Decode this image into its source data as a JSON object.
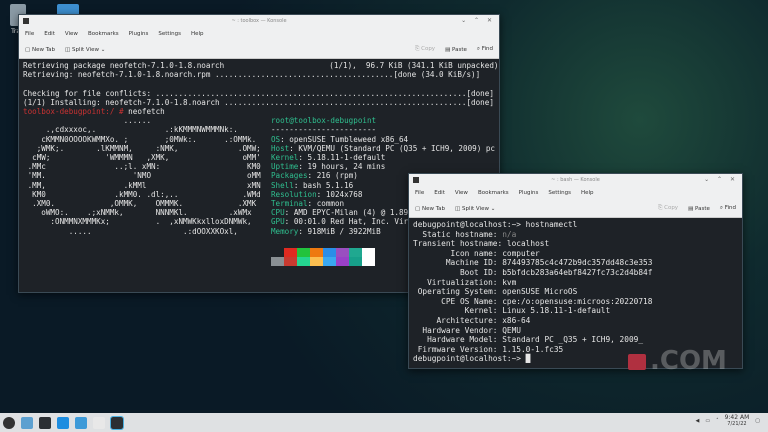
{
  "desktop": {
    "trash_label": "Trash"
  },
  "win1": {
    "title": "~ : toolbox — Konsole",
    "menu": [
      "File",
      "Edit",
      "View",
      "Bookmarks",
      "Plugins",
      "Settings",
      "Help"
    ],
    "toolbar": {
      "new_tab": "New Tab",
      "split_view": "Split View",
      "copy": "Copy",
      "paste": "Paste",
      "find": "Find"
    },
    "lines": [
      "Retrieving package neofetch-7.1.0-1.8.noarch                       (1/1),  96.7 KiB (341.1 KiB unpacked)",
      "Retrieving: neofetch-7.1.0-1.8.noarch.rpm .......................................[done (34.0 KiB/s)]",
      "",
      "Checking for file conflicts: ....................................................................[done]",
      "(1/1) Installing: neofetch-7.1.0-1.8.noarch .....................................................[done]"
    ],
    "prompt": "toolbox-debugpoint:/ #",
    "command": "neofetch",
    "ascii": [
      "                      ......",
      "     .,cdxxxoc,.               .:kKMMMNWMMMNk:.",
      "    cKMMN0OOOOKWMMXo. ;        ;0MWk:.      .:OMMk.",
      "   ;WMK;.       .lKMMNM,     :NMK,             .OMW;",
      "  cMW;            'WMMMN   ,XMK,                oMM'",
      " .MMc               ..;l. xMN:                   KM0",
      " 'MM.                   'NMO                     oMM",
      " .MM,                 .kMMl                      xMN",
      "  KM0               .kMM0. .dl:,..              .WMd",
      "  .XM0.            ,OMMK,    OMMMK.            .XMK",
      "    oWMO:.    .;xNMMk,       NNNMKl.         .xWMx",
      "      :ONMMNXMMMKx;          .  ,xNMWKkxlloxDNMWk,",
      "          .....                    .:dOOXXKOxl,"
    ],
    "info_header": "root@toolbox-debugpoint",
    "info_sep": "-----------------------",
    "info": [
      {
        "k": "OS",
        "v": "openSUSE Tumbleweed x86_64"
      },
      {
        "k": "Host",
        "v": "KVM/QEMU (Standard PC (Q35 + ICH9, 2009) pc"
      },
      {
        "k": "Kernel",
        "v": "5.18.11-1-default"
      },
      {
        "k": "Uptime",
        "v": "19 hours, 24 mins"
      },
      {
        "k": "Packages",
        "v": "216 (rpm)"
      },
      {
        "k": "Shell",
        "v": "bash 5.1.16"
      },
      {
        "k": "Resolution",
        "v": "1024x768"
      },
      {
        "k": "Terminal",
        "v": "common"
      },
      {
        "k": "CPU",
        "v": "AMD EPYC-Milan (4) @ 1.896GHz"
      },
      {
        "k": "GPU",
        "v": "00:01.0 Red Hat, Inc. Virtio GPU"
      },
      {
        "k": "Memory",
        "v": "918MiB / 3922MiB"
      }
    ],
    "palette_top": [
      "#1e2227",
      "#e02a20",
      "#22c33d",
      "#ee7a10",
      "#2a8ee8",
      "#9a4fc0",
      "#20a890",
      "#ffffff"
    ],
    "palette_bottom": [
      "#8a9094",
      "#c83a30",
      "#25d590",
      "#fbbf50",
      "#3aa8f0",
      "#9a40c8",
      "#17a08a",
      "#ffffff"
    ]
  },
  "win2": {
    "title": "~ : bash — Konsole",
    "menu": [
      "File",
      "Edit",
      "View",
      "Bookmarks",
      "Plugins",
      "Settings",
      "Help"
    ],
    "toolbar": {
      "new_tab": "New Tab",
      "split_view": "Split View",
      "copy": "Copy",
      "paste": "Paste",
      "find": "Find"
    },
    "prompt": "debugpoint@localhost:~>",
    "command": "hostnamectl",
    "rows": [
      {
        "k": "  Static hostname:",
        "v": "n/a"
      },
      {
        "k": "Transient hostname:",
        "v": "localhost"
      },
      {
        "k": "        Icon name:",
        "v": "computer"
      },
      {
        "k": "       Machine ID:",
        "v": "874493785c4c472b9dc357dd48c3e353"
      },
      {
        "k": "          Boot ID:",
        "v": "b5bfdcb283a64ebf8427fc73c2d4b84f"
      },
      {
        "k": "   Virtualization:",
        "v": "kvm"
      },
      {
        "k": " Operating System:",
        "v": "openSUSE MicroOS"
      },
      {
        "k": "      CPE OS Name:",
        "v": "cpe:/o:opensuse:microos:20220718"
      },
      {
        "k": "           Kernel:",
        "v": "Linux 5.18.11-1-default"
      },
      {
        "k": "     Architecture:",
        "v": "x86-64"
      },
      {
        "k": "  Hardware Vendor:",
        "v": "QEMU"
      },
      {
        "k": "   Hardware Model:",
        "v": "Standard PC _Q35 + ICH9, 2009_"
      },
      {
        "k": " Firmware Version:",
        "v": "1.15.0-1.fc35"
      }
    ]
  },
  "watermark": ".COM",
  "taskbar": {
    "time": "9:42 AM",
    "date": "7/21/22"
  }
}
